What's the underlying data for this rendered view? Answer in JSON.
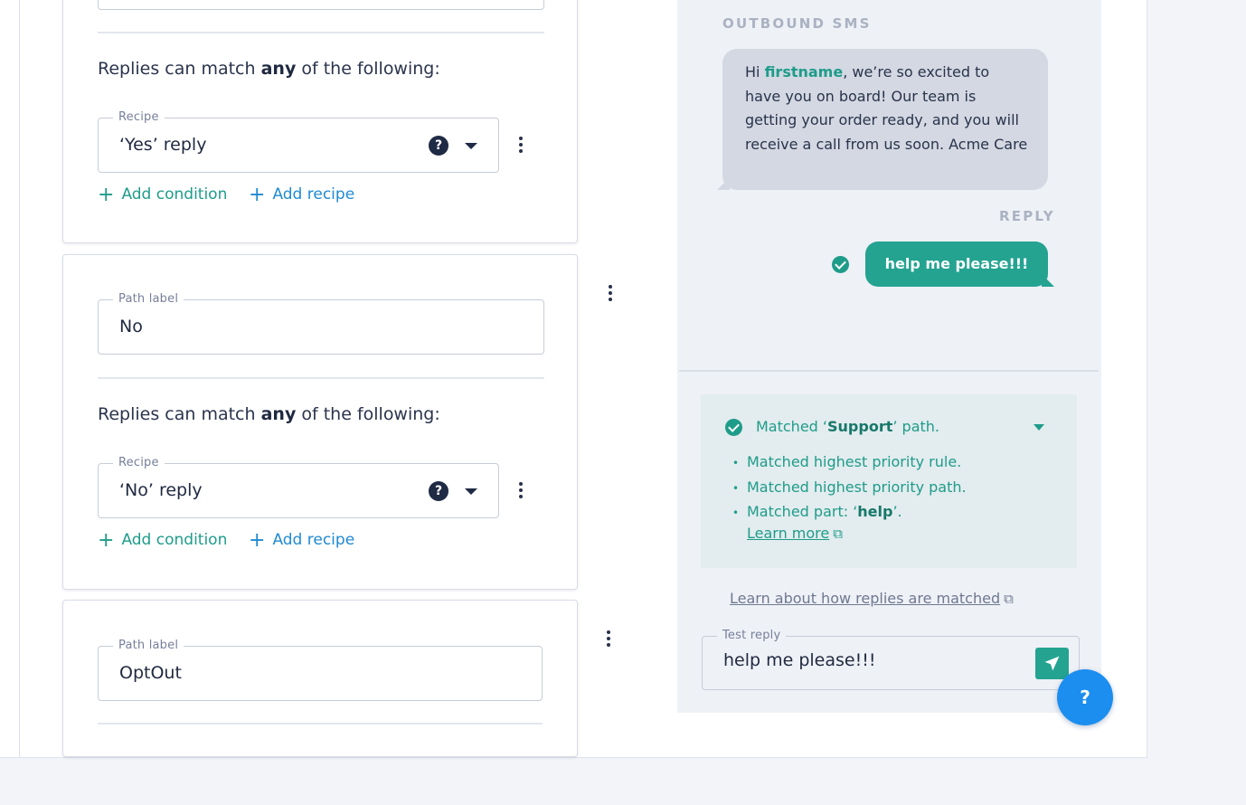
{
  "paths": [
    {
      "match_prefix": "Replies can match ",
      "match_bold": "any",
      "match_suffix": " of the following:",
      "recipe_legend": "Recipe",
      "recipe_value": "‘Yes’ reply",
      "add_condition": "Add condition",
      "add_recipe": "Add recipe"
    },
    {
      "label_legend": "Path label",
      "label_value": "No",
      "match_prefix": "Replies can match ",
      "match_bold": "any",
      "match_suffix": " of the following:",
      "recipe_legend": "Recipe",
      "recipe_value": "‘No’ reply",
      "add_condition": "Add condition",
      "add_recipe": "Add recipe"
    },
    {
      "label_legend": "Path label",
      "label_value": "OptOut"
    }
  ],
  "preview": {
    "outbound_label": "OUTBOUND SMS",
    "sms": {
      "greeting": "Hi ",
      "variable": "firstname",
      "body": ", we’re so excited to have you on board! Our team is getting your order ready, and you will receive a call from us soon. Acme Care"
    },
    "reply_label": "REPLY",
    "reply_text": "help me please!!!",
    "match": {
      "title_prefix": "Matched ‘",
      "title_bold": "Support",
      "title_suffix": "’ path.",
      "items": [
        "Matched highest priority rule.",
        "Matched highest priority path."
      ],
      "part_prefix": "Matched part: ‘",
      "part_bold": "help",
      "part_suffix": "’.",
      "learn_more": "Learn more"
    },
    "learn_how": "Learn about how replies are matched",
    "test_legend": "Test reply",
    "test_value": "help me please!!!"
  },
  "help_fab": "?",
  "colors": {
    "accent_teal": "#24a391",
    "link_blue": "#1f8ad2",
    "fab_blue": "#1b8ef0"
  }
}
